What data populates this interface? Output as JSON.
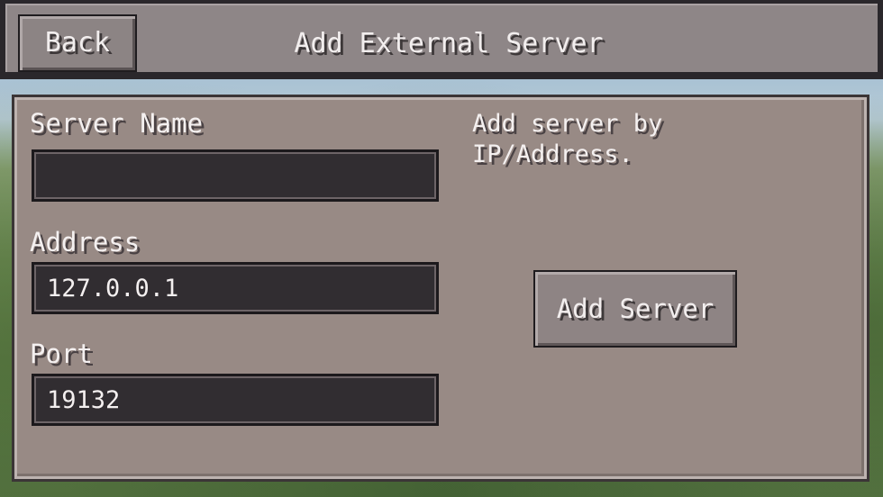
{
  "header": {
    "back_label": "Back",
    "title": "Add External Server"
  },
  "form": {
    "server_name": {
      "label": "Server Name",
      "value": ""
    },
    "address": {
      "label": "Address",
      "value": "127.0.0.1"
    },
    "port": {
      "label": "Port",
      "value": "19132"
    }
  },
  "info": {
    "hint": "Add server by IP/Address."
  },
  "actions": {
    "add_server_label": "Add Server"
  },
  "colors": {
    "panel": "#988a85",
    "field_background": "#312d31",
    "button_face": "#8e8484",
    "header_bar": "#8e8687"
  }
}
